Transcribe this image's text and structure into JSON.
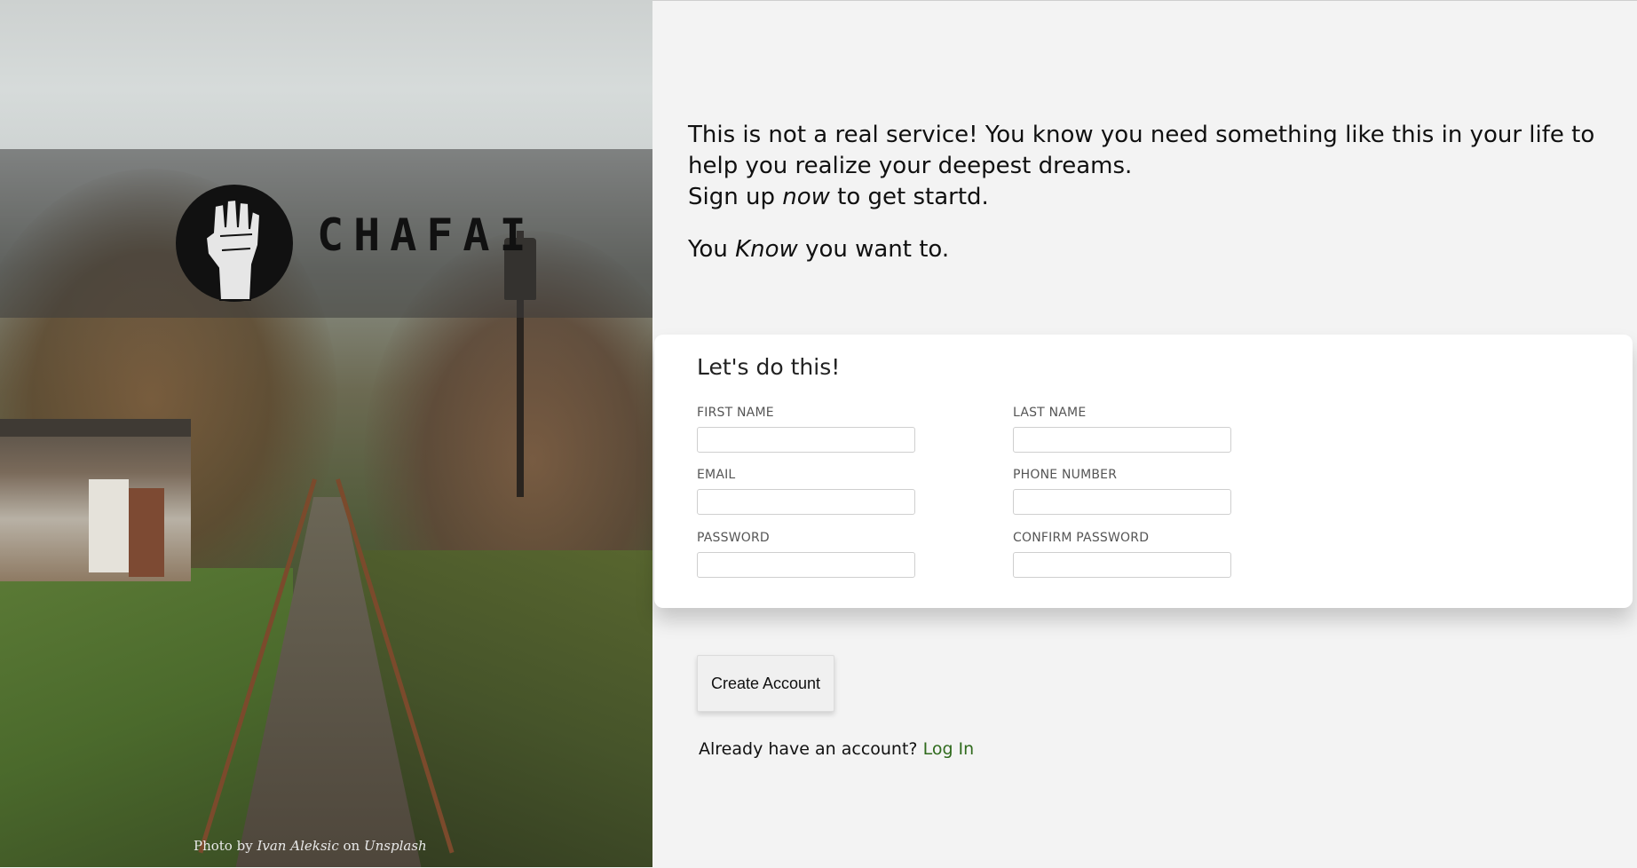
{
  "brand": {
    "name": "CHAFAI",
    "logo_icon": "raised-fist-icon"
  },
  "photo_credit": {
    "prefix": "Photo by",
    "author": "Ivan Aleksic",
    "middle": "on",
    "source": "Unsplash"
  },
  "intro": {
    "line1": "This is not a real service! You know you need something like this in your life to help you realize your deepest dreams.",
    "line2_before": "Sign up",
    "line2_em": "now",
    "line2_after": "to get startd.",
    "line3_before": "You",
    "line3_em": "Know",
    "line3_after": "you want to."
  },
  "form": {
    "title": "Let's do this!",
    "fields": {
      "first_name": {
        "label": "FIRST NAME",
        "value": ""
      },
      "last_name": {
        "label": "LAST NAME",
        "value": ""
      },
      "email": {
        "label": "EMAIL",
        "value": ""
      },
      "phone": {
        "label": "PHONE NUMBER",
        "value": ""
      },
      "password": {
        "label": "PASSWORD",
        "value": ""
      },
      "confirm_password": {
        "label": "CONFIRM PASSWORD",
        "value": ""
      }
    }
  },
  "actions": {
    "create_account": "Create Account",
    "login_prompt": "Already have an account?",
    "login_link": "Log In"
  },
  "colors": {
    "link": "#2f6a1c",
    "page_bg": "#f3f3f3",
    "card_bg": "#ffffff"
  }
}
